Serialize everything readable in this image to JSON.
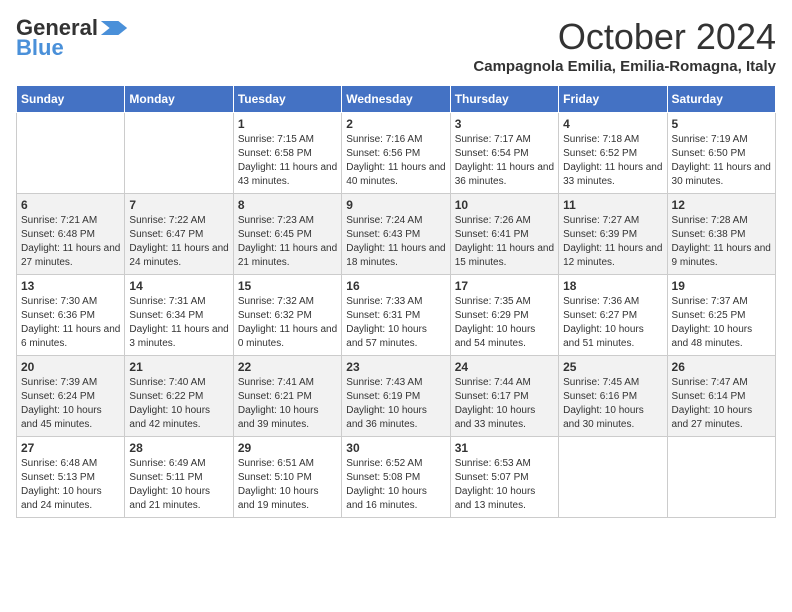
{
  "header": {
    "logo_line1": "General",
    "logo_line2": "Blue",
    "month": "October 2024",
    "location": "Campagnola Emilia, Emilia-Romagna, Italy"
  },
  "days_of_week": [
    "Sunday",
    "Monday",
    "Tuesday",
    "Wednesday",
    "Thursday",
    "Friday",
    "Saturday"
  ],
  "weeks": [
    [
      {
        "day": "",
        "info": ""
      },
      {
        "day": "",
        "info": ""
      },
      {
        "day": "1",
        "info": "Sunrise: 7:15 AM\nSunset: 6:58 PM\nDaylight: 11 hours and 43 minutes."
      },
      {
        "day": "2",
        "info": "Sunrise: 7:16 AM\nSunset: 6:56 PM\nDaylight: 11 hours and 40 minutes."
      },
      {
        "day": "3",
        "info": "Sunrise: 7:17 AM\nSunset: 6:54 PM\nDaylight: 11 hours and 36 minutes."
      },
      {
        "day": "4",
        "info": "Sunrise: 7:18 AM\nSunset: 6:52 PM\nDaylight: 11 hours and 33 minutes."
      },
      {
        "day": "5",
        "info": "Sunrise: 7:19 AM\nSunset: 6:50 PM\nDaylight: 11 hours and 30 minutes."
      }
    ],
    [
      {
        "day": "6",
        "info": "Sunrise: 7:21 AM\nSunset: 6:48 PM\nDaylight: 11 hours and 27 minutes."
      },
      {
        "day": "7",
        "info": "Sunrise: 7:22 AM\nSunset: 6:47 PM\nDaylight: 11 hours and 24 minutes."
      },
      {
        "day": "8",
        "info": "Sunrise: 7:23 AM\nSunset: 6:45 PM\nDaylight: 11 hours and 21 minutes."
      },
      {
        "day": "9",
        "info": "Sunrise: 7:24 AM\nSunset: 6:43 PM\nDaylight: 11 hours and 18 minutes."
      },
      {
        "day": "10",
        "info": "Sunrise: 7:26 AM\nSunset: 6:41 PM\nDaylight: 11 hours and 15 minutes."
      },
      {
        "day": "11",
        "info": "Sunrise: 7:27 AM\nSunset: 6:39 PM\nDaylight: 11 hours and 12 minutes."
      },
      {
        "day": "12",
        "info": "Sunrise: 7:28 AM\nSunset: 6:38 PM\nDaylight: 11 hours and 9 minutes."
      }
    ],
    [
      {
        "day": "13",
        "info": "Sunrise: 7:30 AM\nSunset: 6:36 PM\nDaylight: 11 hours and 6 minutes."
      },
      {
        "day": "14",
        "info": "Sunrise: 7:31 AM\nSunset: 6:34 PM\nDaylight: 11 hours and 3 minutes."
      },
      {
        "day": "15",
        "info": "Sunrise: 7:32 AM\nSunset: 6:32 PM\nDaylight: 11 hours and 0 minutes."
      },
      {
        "day": "16",
        "info": "Sunrise: 7:33 AM\nSunset: 6:31 PM\nDaylight: 10 hours and 57 minutes."
      },
      {
        "day": "17",
        "info": "Sunrise: 7:35 AM\nSunset: 6:29 PM\nDaylight: 10 hours and 54 minutes."
      },
      {
        "day": "18",
        "info": "Sunrise: 7:36 AM\nSunset: 6:27 PM\nDaylight: 10 hours and 51 minutes."
      },
      {
        "day": "19",
        "info": "Sunrise: 7:37 AM\nSunset: 6:25 PM\nDaylight: 10 hours and 48 minutes."
      }
    ],
    [
      {
        "day": "20",
        "info": "Sunrise: 7:39 AM\nSunset: 6:24 PM\nDaylight: 10 hours and 45 minutes."
      },
      {
        "day": "21",
        "info": "Sunrise: 7:40 AM\nSunset: 6:22 PM\nDaylight: 10 hours and 42 minutes."
      },
      {
        "day": "22",
        "info": "Sunrise: 7:41 AM\nSunset: 6:21 PM\nDaylight: 10 hours and 39 minutes."
      },
      {
        "day": "23",
        "info": "Sunrise: 7:43 AM\nSunset: 6:19 PM\nDaylight: 10 hours and 36 minutes."
      },
      {
        "day": "24",
        "info": "Sunrise: 7:44 AM\nSunset: 6:17 PM\nDaylight: 10 hours and 33 minutes."
      },
      {
        "day": "25",
        "info": "Sunrise: 7:45 AM\nSunset: 6:16 PM\nDaylight: 10 hours and 30 minutes."
      },
      {
        "day": "26",
        "info": "Sunrise: 7:47 AM\nSunset: 6:14 PM\nDaylight: 10 hours and 27 minutes."
      }
    ],
    [
      {
        "day": "27",
        "info": "Sunrise: 6:48 AM\nSunset: 5:13 PM\nDaylight: 10 hours and 24 minutes."
      },
      {
        "day": "28",
        "info": "Sunrise: 6:49 AM\nSunset: 5:11 PM\nDaylight: 10 hours and 21 minutes."
      },
      {
        "day": "29",
        "info": "Sunrise: 6:51 AM\nSunset: 5:10 PM\nDaylight: 10 hours and 19 minutes."
      },
      {
        "day": "30",
        "info": "Sunrise: 6:52 AM\nSunset: 5:08 PM\nDaylight: 10 hours and 16 minutes."
      },
      {
        "day": "31",
        "info": "Sunrise: 6:53 AM\nSunset: 5:07 PM\nDaylight: 10 hours and 13 minutes."
      },
      {
        "day": "",
        "info": ""
      },
      {
        "day": "",
        "info": ""
      }
    ]
  ]
}
